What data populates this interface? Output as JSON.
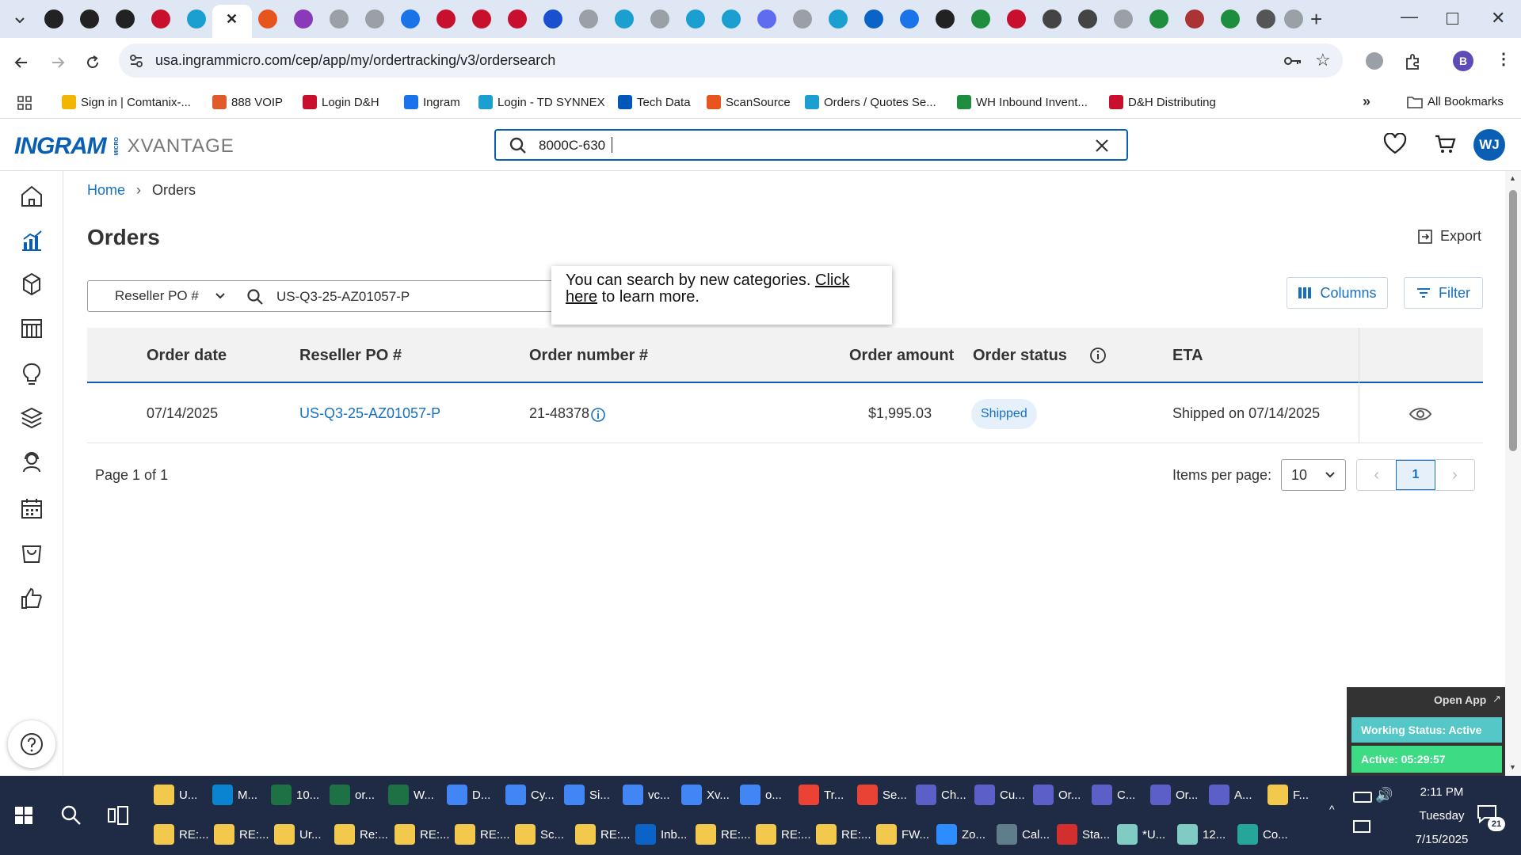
{
  "browser": {
    "url": "usa.ingrammicro.com/cep/app/my/ordertracking/v3/ordersearch",
    "profile_initial": "B",
    "bookmarks": [
      {
        "label": "Sign in | Comtanix-...",
        "color": "#f2b600"
      },
      {
        "label": "888 VOIP",
        "color": "#e05a2b"
      },
      {
        "label": "Login D&H",
        "color": "#c8102e"
      },
      {
        "label": "Ingram",
        "color": "#1a73e8"
      },
      {
        "label": "Login - TD SYNNEX",
        "color": "#1a9fd0"
      },
      {
        "label": "Tech Data",
        "color": "#0057b8"
      },
      {
        "label": "ScanSource",
        "color": "#e8541e"
      },
      {
        "label": "Orders / Quotes Se...",
        "color": "#1a9fd0"
      },
      {
        "label": "WH Inbound Invent...",
        "color": "#1e8e3e"
      },
      {
        "label": "D&H Distributing",
        "color": "#c8102e"
      }
    ],
    "all_bookmarks": "All Bookmarks"
  },
  "app": {
    "logo_brand": "INGRAM",
    "logo_micro": "MICRO",
    "logo_product": "XVANTAGE",
    "search_value": "8000C-630",
    "user_initials": "WJ"
  },
  "page": {
    "breadcrumb_home": "Home",
    "breadcrumb_current": "Orders",
    "title": "Orders",
    "export_label": "Export",
    "columns_label": "Columns",
    "filter_label": "Filter",
    "search_category": "Reseller PO #",
    "search_value": "US-Q3-25-AZ01057-P",
    "tooltip_text": "You can search by new categories.",
    "tooltip_link": "Click here",
    "tooltip_tail": "to learn more."
  },
  "table": {
    "headers": {
      "order_date": "Order date",
      "reseller_po": "Reseller PO #",
      "order_number": "Order number #",
      "order_amount": "Order amount",
      "order_status": "Order status",
      "eta": "ETA"
    },
    "rows": [
      {
        "order_date": "07/14/2025",
        "reseller_po": "US-Q3-25-AZ01057-P",
        "order_number": "21-48378",
        "order_amount": "$1,995.03",
        "order_status": "Shipped",
        "eta": "Shipped on 07/14/2025"
      }
    ]
  },
  "pagination": {
    "page_info": "Page 1 of 1",
    "items_per_page_label": "Items per page:",
    "items_per_page": "10",
    "current_page": "1"
  },
  "widget": {
    "open_app": "Open App",
    "working_status": "Working Status: Active",
    "active_timer": "Active: 05:29:57"
  },
  "taskbar": {
    "row1": [
      {
        "label": "U...",
        "color": "#f2c94c"
      },
      {
        "label": "M...",
        "color": "#0a84d0"
      },
      {
        "label": "10...",
        "color": "#1e7145"
      },
      {
        "label": "or...",
        "color": "#1e7145"
      },
      {
        "label": "W...",
        "color": "#1e7145"
      },
      {
        "label": "D...",
        "color": "#4285f4"
      },
      {
        "label": "Cy...",
        "color": "#4285f4"
      },
      {
        "label": "Si...",
        "color": "#4285f4"
      },
      {
        "label": "vc...",
        "color": "#4285f4"
      },
      {
        "label": "Xv...",
        "color": "#4285f4"
      },
      {
        "label": "o...",
        "color": "#4285f4"
      },
      {
        "label": "Tr...",
        "color": "#ea4335"
      },
      {
        "label": "Se...",
        "color": "#ea4335"
      },
      {
        "label": "Ch...",
        "color": "#5b5fc7"
      },
      {
        "label": "Cu...",
        "color": "#5b5fc7"
      },
      {
        "label": "Or...",
        "color": "#5b5fc7"
      },
      {
        "label": "C...",
        "color": "#5b5fc7"
      },
      {
        "label": "Or...",
        "color": "#5b5fc7"
      },
      {
        "label": "A...",
        "color": "#5b5fc7"
      },
      {
        "label": "F...",
        "color": "#f2c94c"
      }
    ],
    "row2": [
      {
        "label": "RE:...",
        "color": "#f2c94c"
      },
      {
        "label": "RE:...",
        "color": "#f2c94c"
      },
      {
        "label": "Ur...",
        "color": "#f2c94c"
      },
      {
        "label": "Re:...",
        "color": "#f2c94c"
      },
      {
        "label": "RE:...",
        "color": "#f2c94c"
      },
      {
        "label": "RE:...",
        "color": "#f2c94c"
      },
      {
        "label": "Sc...",
        "color": "#f2c94c"
      },
      {
        "label": "RE:...",
        "color": "#f2c94c"
      },
      {
        "label": "Inb...",
        "color": "#0a64c8"
      },
      {
        "label": "RE:...",
        "color": "#f2c94c"
      },
      {
        "label": "RE:...",
        "color": "#f2c94c"
      },
      {
        "label": "RE:...",
        "color": "#f2c94c"
      },
      {
        "label": "FW...",
        "color": "#f2c94c"
      },
      {
        "label": "Zo...",
        "color": "#2d8cff"
      },
      {
        "label": "Cal...",
        "color": "#607d8b"
      },
      {
        "label": "Sta...",
        "color": "#d32f2f"
      },
      {
        "label": "*U...",
        "color": "#80cbc4"
      },
      {
        "label": "12...",
        "color": "#80cbc4"
      },
      {
        "label": "Co...",
        "color": "#26a69a"
      }
    ],
    "time": "2:11 PM",
    "day": "Tuesday",
    "date": "7/15/2025",
    "notification_count": "21"
  },
  "colors": {
    "brand_blue": "#0a5fb4",
    "link_blue": "#1570c2",
    "status_badge_bg": "#e6f0fb",
    "widget_green": "#3ddc84",
    "widget_teal": "#56c7c7"
  }
}
